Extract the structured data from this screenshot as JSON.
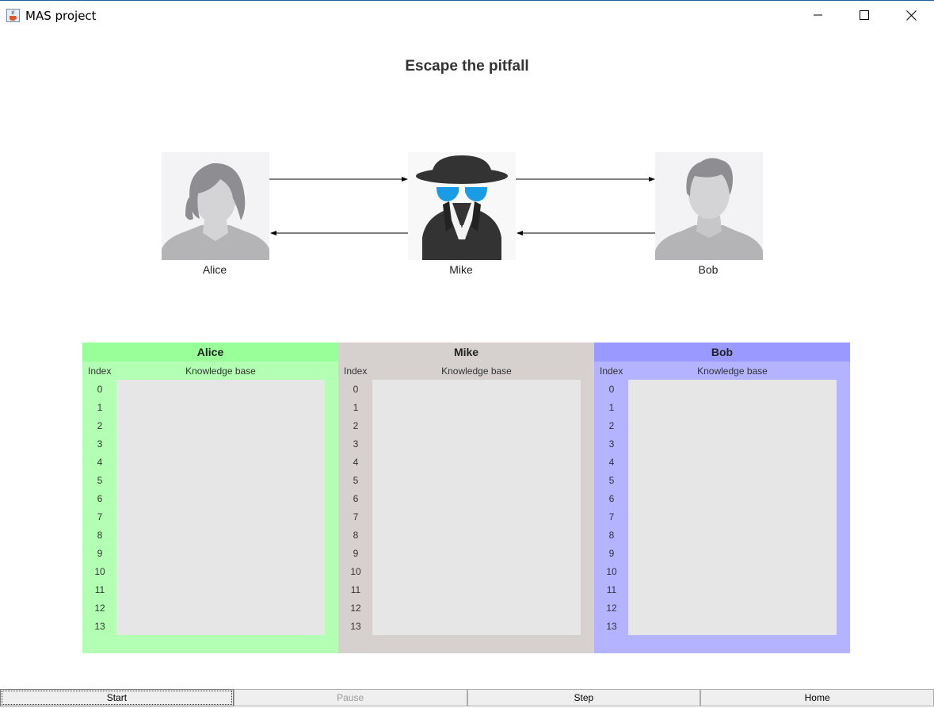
{
  "window": {
    "title": "MAS project",
    "icon": "java-cup-icon",
    "controls": [
      "minimize-icon",
      "maximize-icon",
      "close-icon"
    ]
  },
  "heading": "Escape the pitfall",
  "agents": [
    {
      "name": "Alice",
      "icon": "female-avatar-icon"
    },
    {
      "name": "Mike",
      "icon": "spy-icon"
    },
    {
      "name": "Bob",
      "icon": "male-avatar-icon"
    }
  ],
  "panels": [
    {
      "title": "Alice",
      "index_label": "Index",
      "kb_label": "Knowledge base",
      "header_color": "#99ff99",
      "body_color": "#b3ffb3"
    },
    {
      "title": "Mike",
      "index_label": "Index",
      "kb_label": "Knowledge base",
      "header_color": "#d6d0cf",
      "body_color": "#d6d0cf"
    },
    {
      "title": "Bob",
      "index_label": "Index",
      "kb_label": "Knowledge base",
      "header_color": "#9999ff",
      "body_color": "#b3b3ff"
    }
  ],
  "indices": [
    "0",
    "1",
    "2",
    "3",
    "4",
    "5",
    "6",
    "7",
    "8",
    "9",
    "10",
    "11",
    "12",
    "13"
  ],
  "buttons": {
    "start": "Start",
    "pause": "Pause",
    "step": "Step",
    "home": "Home"
  }
}
